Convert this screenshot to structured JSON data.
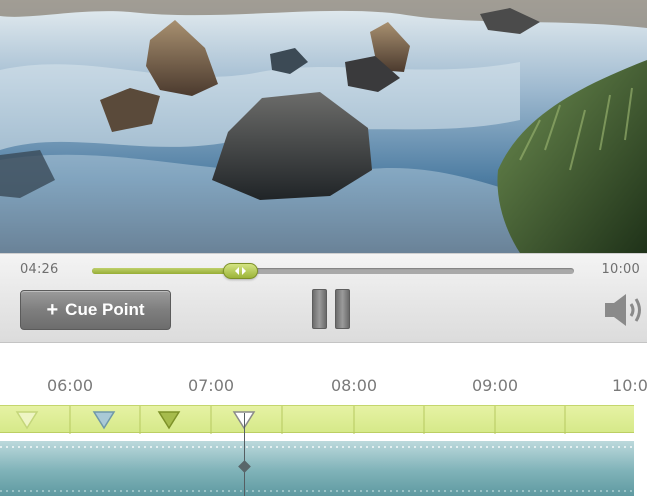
{
  "player": {
    "current_time": "04:26",
    "total_time": "10:00",
    "progress": 0.307
  },
  "controls": {
    "cue_point_label": "Cue Point",
    "cue_point_icon": "+"
  },
  "timeline": {
    "ticks": [
      "06:00",
      "07:00",
      "08:00",
      "09:00",
      "10:0"
    ]
  },
  "colors": {
    "accent_green": "#a2b843",
    "cue_track": "#dcec95",
    "video_track": "#7fb2b8"
  },
  "icons": [
    "plus-icon",
    "pause-icon",
    "speaker-icon",
    "slider-grip-icon",
    "cue-marker-icon",
    "playhead-icon"
  ]
}
